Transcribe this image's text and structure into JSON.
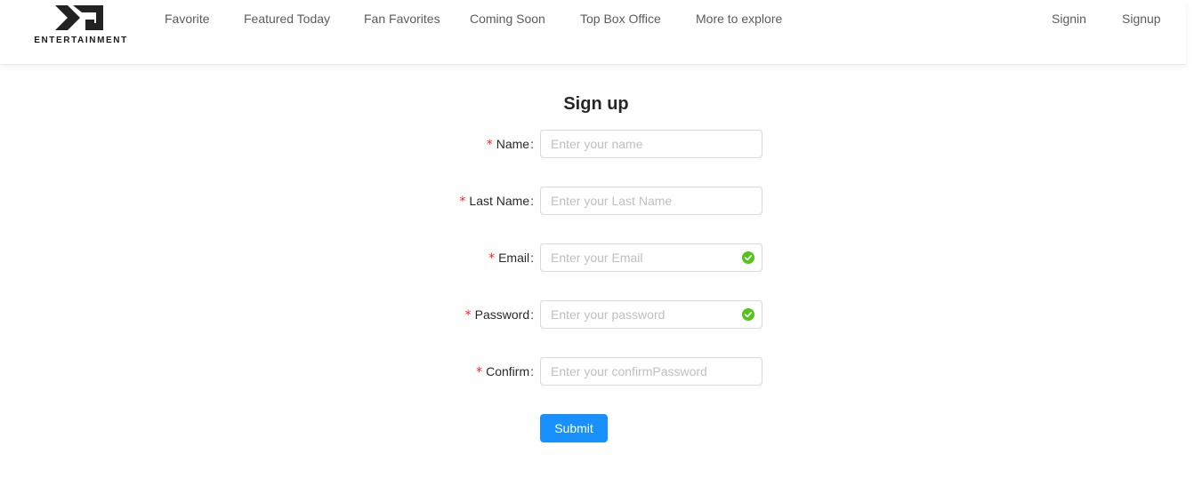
{
  "brand": {
    "logo_text": "ENTERTAINMENT"
  },
  "nav": {
    "items": [
      {
        "label": "Favorite"
      },
      {
        "label": "Featured Today"
      },
      {
        "label": "Fan Favorites"
      },
      {
        "label": "Coming Soon"
      },
      {
        "label": "Top Box Office"
      },
      {
        "label": "More to explore"
      }
    ],
    "auth": {
      "signin": "Signin",
      "signup": "Signup"
    }
  },
  "form": {
    "title": "Sign up",
    "required_mark": "*",
    "colon": ":",
    "fields": [
      {
        "label": "Name",
        "placeholder": "Enter your name",
        "value": "",
        "valid": false
      },
      {
        "label": "Last Name",
        "placeholder": "Enter your Last Name",
        "value": "",
        "valid": false
      },
      {
        "label": "Email",
        "placeholder": "Enter your Email",
        "value": "",
        "valid": true
      },
      {
        "label": "Password",
        "placeholder": "Enter your password",
        "value": "",
        "valid": true
      },
      {
        "label": "Confirm",
        "placeholder": "Enter your confirmPassword",
        "value": "",
        "valid": false
      }
    ],
    "submit_label": "Submit",
    "valid_icon": "check-circle-icon"
  },
  "colors": {
    "primary": "#1890ff",
    "success": "#52c41a",
    "required": "#f5222d"
  }
}
